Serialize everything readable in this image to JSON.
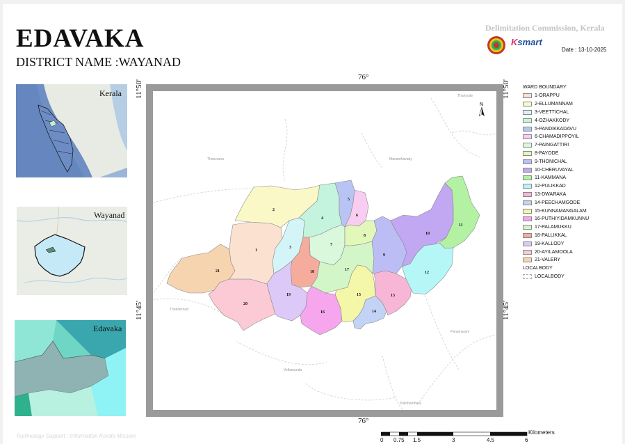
{
  "header": {
    "title": "EDAVAKA",
    "district": "DISTRICT NAME :WAYANAD",
    "commission": "Delimitation Commission, Kerala",
    "ksmart_k": "K",
    "ksmart_rest": "smart",
    "date": "Date : 13-10-2025"
  },
  "insets": {
    "state": "Kerala",
    "district": "Wayanad",
    "localbody": "Edavaka"
  },
  "grid": {
    "lon_top": "76°",
    "lon_bottom": "76°",
    "lat_top_left": "11°50'",
    "lat_top_right": "11°50'",
    "lat_bottom_left": "11°45'",
    "lat_bottom_right": "11°45'"
  },
  "north_label": "N",
  "places": [
    {
      "id": "thariyode",
      "name": "Thariyode"
    },
    {
      "id": "tharuvana",
      "name": "Tharuvana"
    },
    {
      "id": "mananthavady",
      "name": "Mananthavady"
    },
    {
      "id": "thondernad",
      "name": "Thondernad"
    },
    {
      "id": "panamaram",
      "name": "Panamaram"
    },
    {
      "id": "vellamunda",
      "name": "Vellamunda"
    },
    {
      "id": "pulinhanthara",
      "name": "Pulinhanthara"
    }
  ],
  "legend": {
    "title": "WARD BOUNDARY",
    "wards": [
      {
        "label": "1-ORAPPU",
        "color": "#fbe1d0",
        "num": "1"
      },
      {
        "label": "2-ELLUMANNAM",
        "color": "#fbf8c8",
        "num": "2"
      },
      {
        "label": "3-VEETTICHAL",
        "color": "#d4f5f8",
        "num": "3"
      },
      {
        "label": "4-OZHAKKODY",
        "color": "#c4f4dd",
        "num": "4"
      },
      {
        "label": "5-PANDIKKADAVU",
        "color": "#b8c4f3",
        "num": "5"
      },
      {
        "label": "6-CHAMADIPPOYIL",
        "color": "#f8cdf1",
        "num": "6"
      },
      {
        "label": "7-PAINGATTIRI",
        "color": "#d9f8dc",
        "num": "7"
      },
      {
        "label": "8-PAYODE",
        "color": "#e1f8ba",
        "num": "8"
      },
      {
        "label": "9-THONICHAL",
        "color": "#bdbdf5",
        "num": "9"
      },
      {
        "label": "10-CHERUVAYAL",
        "color": "#c2a7f2",
        "num": "10"
      },
      {
        "label": "11-KAMMANA",
        "color": "#b3f1a3",
        "num": "11"
      },
      {
        "label": "12-PULIKKAD",
        "color": "#b5f7f6",
        "num": "12"
      },
      {
        "label": "13-DWARAKA",
        "color": "#f8b6d6",
        "num": "13"
      },
      {
        "label": "14-PEECHAMGODE",
        "color": "#c2d3f5",
        "num": "14"
      },
      {
        "label": "15-KUNNAMANGALAM",
        "color": "#f5f7a8",
        "num": "15"
      },
      {
        "label": "16-PUTHIYIDAMKUNNU",
        "color": "#f6a6ec",
        "num": "16"
      },
      {
        "label": "17-PALAMUKKU",
        "color": "#d3f6c9",
        "num": "17"
      },
      {
        "label": "18-PALLIKKAL",
        "color": "#f6ac9c",
        "num": "18"
      },
      {
        "label": "19-KALLODY",
        "color": "#dcc9f7",
        "num": "19"
      },
      {
        "label": "20-AYILAMOOLA",
        "color": "#fbcad5",
        "num": "20"
      },
      {
        "label": "21-VALERY",
        "color": "#f7d4b0",
        "num": "21"
      }
    ],
    "localbody_title": "LOCALBODY",
    "localbody_label": "LOCALBODY"
  },
  "scale": {
    "unit": "Kilometers",
    "ticks": [
      "0",
      "0.75",
      "1.5",
      "3",
      "4.5",
      "6"
    ]
  },
  "footer": "Technology Support : Information Kerala Mission"
}
